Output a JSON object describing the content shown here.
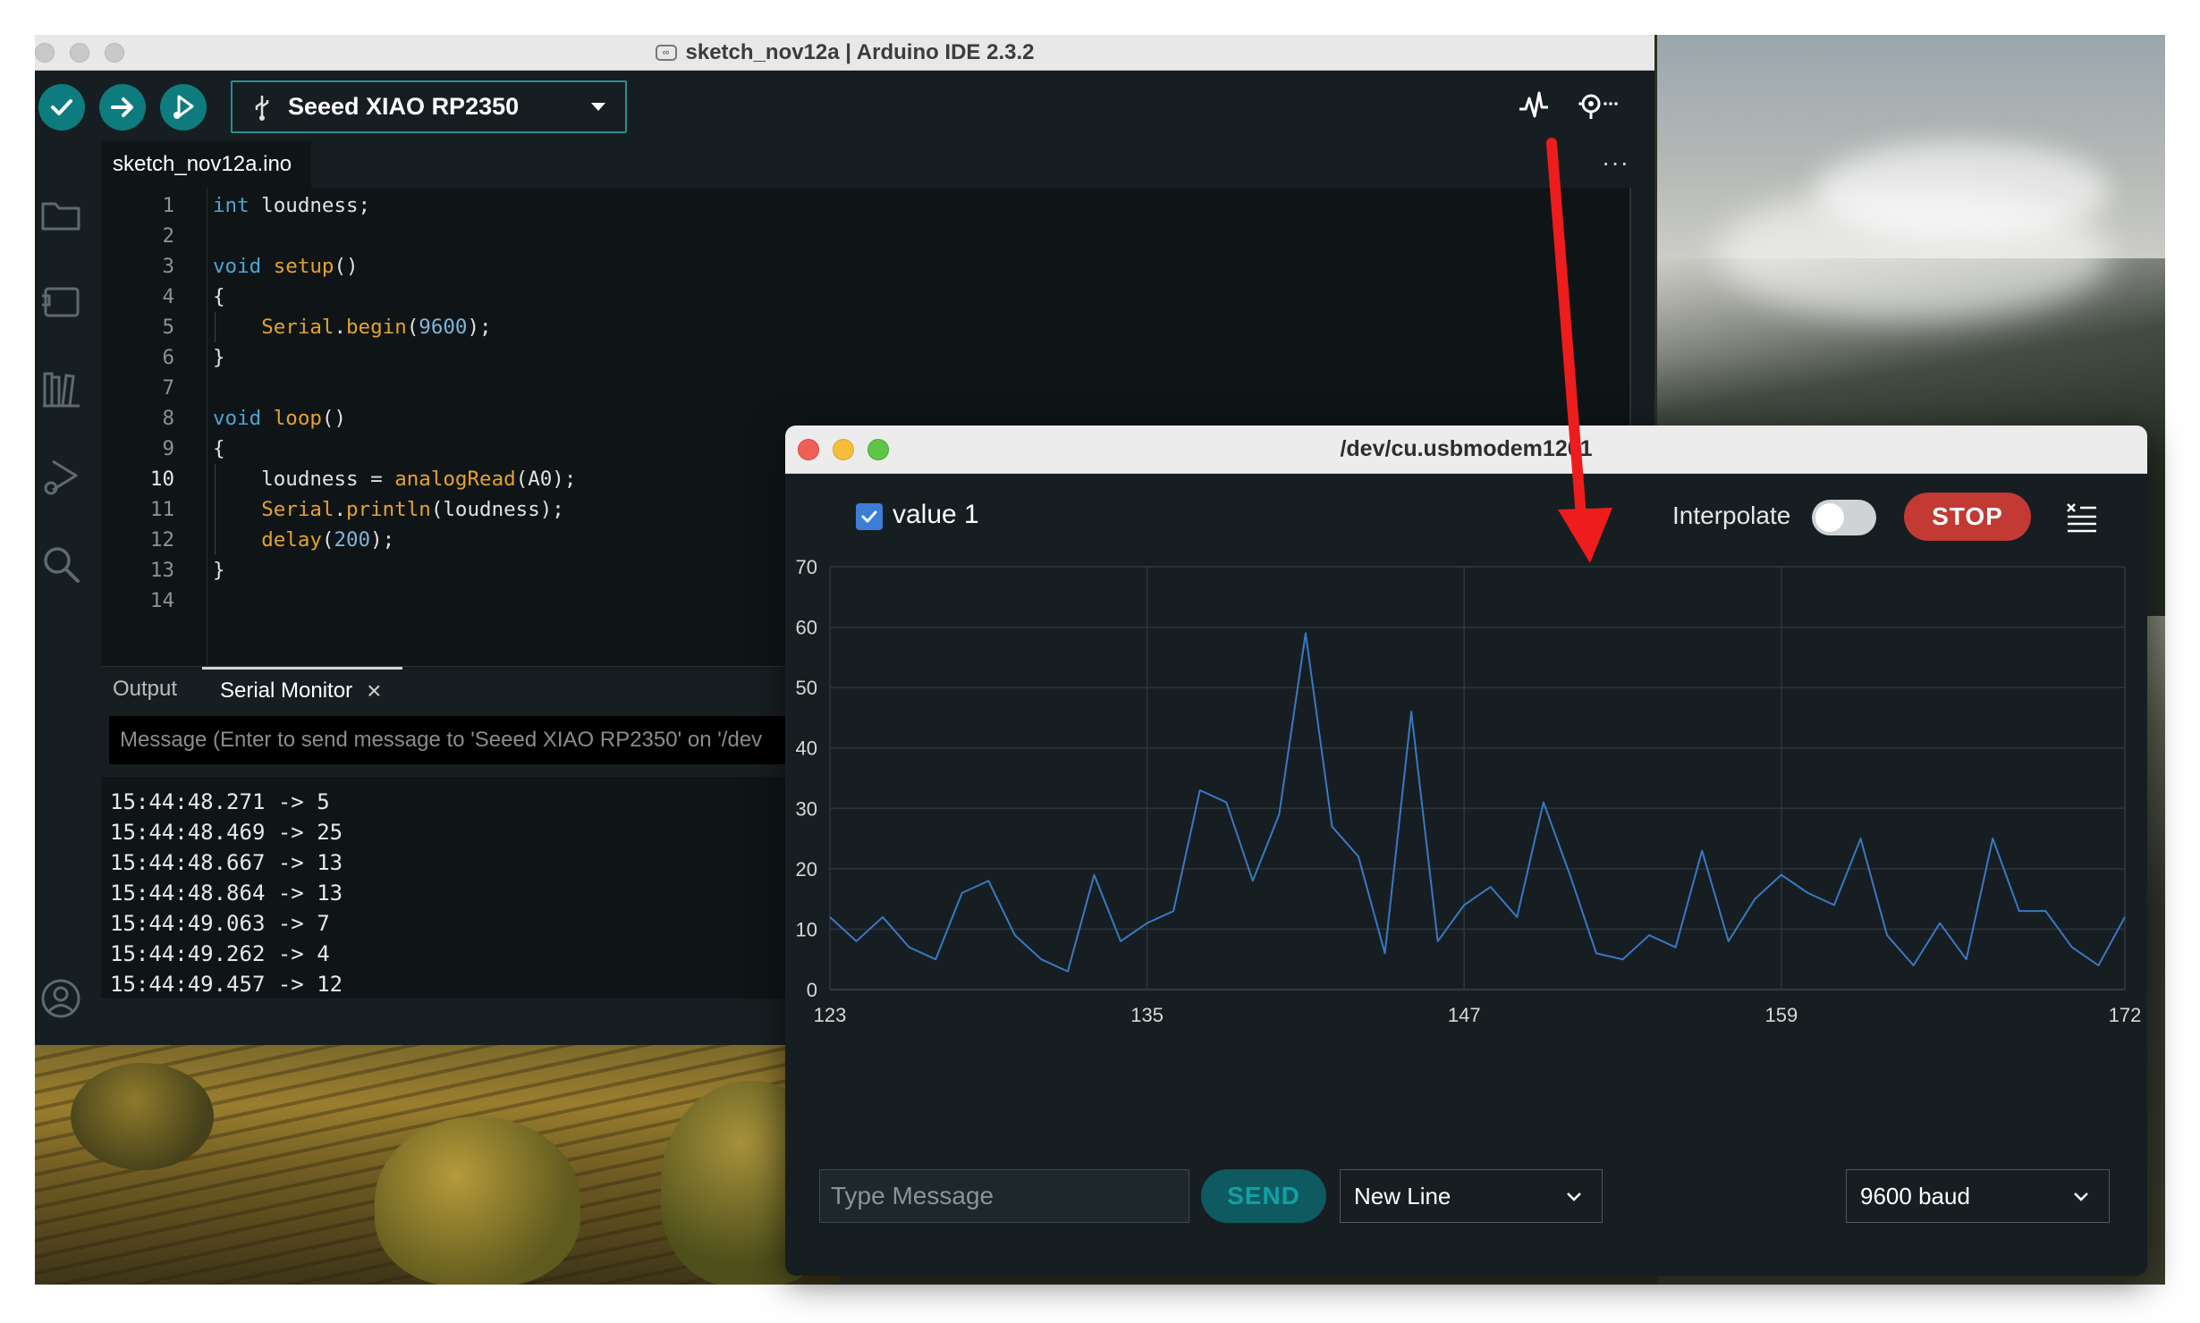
{
  "ide": {
    "title": "sketch_nov12a | Arduino IDE 2.3.2",
    "board": "Seeed XIAO RP2350",
    "file_tab": "sketch_nov12a.ino",
    "more": "···",
    "active_line": 10
  },
  "code": [
    {
      "n": "1",
      "html": "<span class='kw'>int</span> loudness;"
    },
    {
      "n": "2",
      "html": ""
    },
    {
      "n": "3",
      "html": "<span class='kw'>void</span> <span class='fn'>setup</span>()"
    },
    {
      "n": "4",
      "html": "{"
    },
    {
      "n": "5",
      "html": "    <span class='fn'>Serial</span>.<span class='fn'>begin</span>(<span class='num'>9600</span>);"
    },
    {
      "n": "6",
      "html": "}"
    },
    {
      "n": "7",
      "html": ""
    },
    {
      "n": "8",
      "html": "<span class='kw'>void</span> <span class='fn'>loop</span>()"
    },
    {
      "n": "9",
      "html": "{"
    },
    {
      "n": "10",
      "html": "    loudness = <span class='fn'>analogRead</span>(A0);"
    },
    {
      "n": "11",
      "html": "    <span class='fn'>Serial</span>.<span class='fn'>println</span>(loudness);"
    },
    {
      "n": "12",
      "html": "    <span class='fn'>delay</span>(<span class='num'>200</span>);"
    },
    {
      "n": "13",
      "html": "}"
    },
    {
      "n": "14",
      "html": ""
    }
  ],
  "panel": {
    "tab_output": "Output",
    "tab_serial": "Serial Monitor",
    "close": "×",
    "message_placeholder": "Message (Enter to send message to 'Seeed XIAO RP2350' on '/dev"
  },
  "serial_lines": [
    "15:44:48.271 -> 5",
    "15:44:48.469 -> 25",
    "15:44:48.667 -> 13",
    "15:44:48.864 -> 13",
    "15:44:49.063 -> 7",
    "15:44:49.262 -> 4",
    "15:44:49.457 -> 12"
  ],
  "plotter": {
    "title": "/dev/cu.usbmodem1201",
    "legend_label": "value 1",
    "interpolate_label": "Interpolate",
    "interpolate_on": false,
    "stop_label": "STOP",
    "type_message_placeholder": "Type Message",
    "send_label": "SEND",
    "line_ending": "New Line",
    "baud": "9600 baud"
  },
  "colors": {
    "accent": "#0e7c7e",
    "series": "#3a78c4",
    "stop": "#c23a33",
    "arrow": "#ee1c1c"
  },
  "icons": {
    "verify": "check-icon",
    "upload": "arrow-right-icon",
    "debug": "debug-icon",
    "usb": "usb-icon",
    "plotter": "serial-plotter-icon",
    "monitor": "serial-monitor-icon",
    "clear": "clear-list-icon"
  },
  "chart_data": {
    "type": "line",
    "x": [
      123,
      124,
      125,
      126,
      127,
      128,
      129,
      130,
      131,
      132,
      133,
      134,
      135,
      136,
      137,
      138,
      139,
      140,
      141,
      142,
      143,
      144,
      145,
      146,
      147,
      148,
      149,
      150,
      151,
      152,
      153,
      154,
      155,
      156,
      157,
      158,
      159,
      160,
      161,
      162,
      163,
      164,
      165,
      166,
      167,
      168,
      169,
      170,
      171,
      172
    ],
    "series": [
      {
        "name": "value 1",
        "values": [
          12,
          8,
          12,
          7,
          5,
          16,
          18,
          9,
          5,
          3,
          19,
          8,
          11,
          13,
          33,
          31,
          18,
          29,
          59,
          27,
          22,
          6,
          46,
          8,
          14,
          17,
          12,
          31,
          19,
          6,
          5,
          9,
          7,
          23,
          8,
          15,
          19,
          16,
          14,
          25,
          9,
          4,
          11,
          5,
          25,
          13,
          13,
          7,
          4,
          12
        ]
      }
    ],
    "xticks": [
      123,
      135,
      147,
      159,
      172
    ],
    "yticks": [
      0,
      10,
      20,
      30,
      40,
      50,
      60,
      70
    ],
    "xlim": [
      123,
      172
    ],
    "ylim": [
      0,
      70
    ],
    "grid": true
  }
}
